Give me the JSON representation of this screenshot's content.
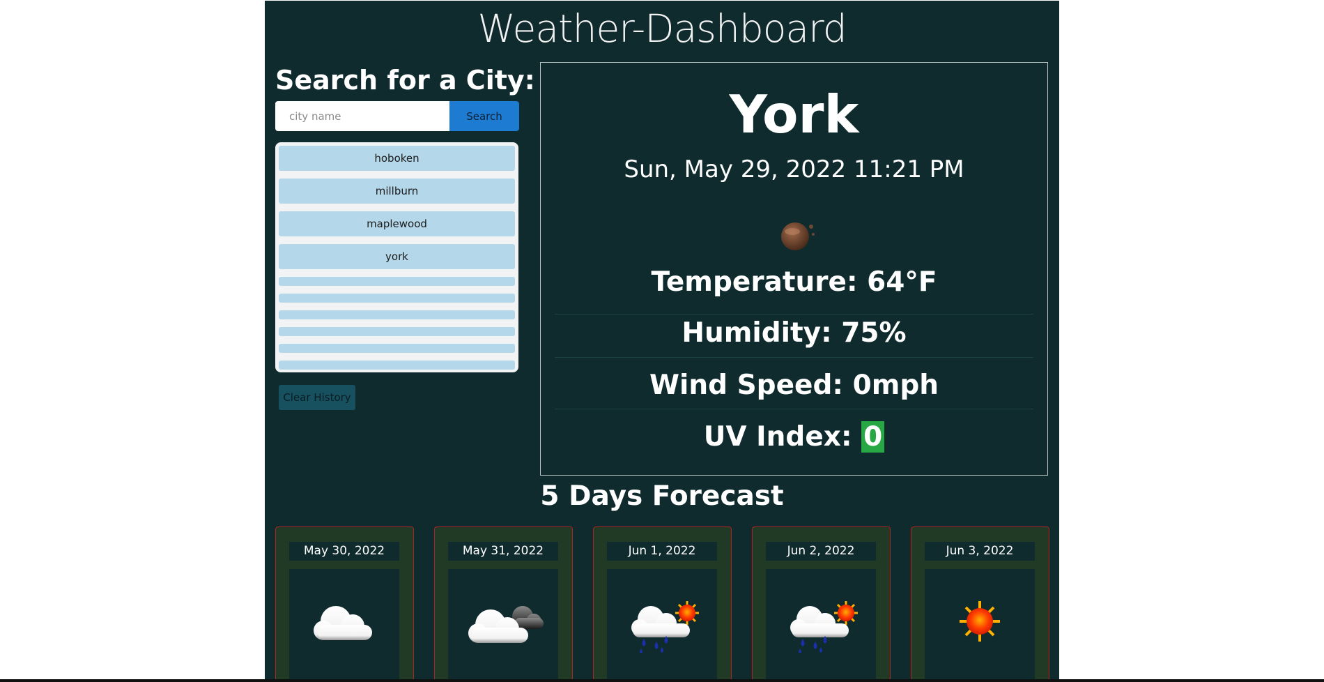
{
  "app": {
    "title": "Weather-Dashboard"
  },
  "search": {
    "heading": "Search for a City:",
    "placeholder": "city name",
    "button_label": "Search"
  },
  "history": {
    "items": [
      "hoboken",
      "millburn",
      "maplewood",
      "york"
    ],
    "clear_label": "Clear History"
  },
  "current": {
    "city": "York",
    "datetime": "Sun, May 29, 2022 11:21 PM",
    "icon": "night-partly-cloudy-moon-icon",
    "temperature_label": "Temperature:",
    "temperature_value": "64°F",
    "humidity_label": "Humidity:",
    "humidity_value": "75%",
    "wind_label": "Wind Speed:",
    "wind_value": "0mph",
    "uv_label": "UV Index:",
    "uv_value": "0",
    "uv_color": "#28a745"
  },
  "forecast": {
    "heading": "5 Days Forecast",
    "days": [
      {
        "date": "May 30, 2022",
        "icon": "cloud-icon"
      },
      {
        "date": "May 31, 2022",
        "icon": "partly-cloudy-night-icon"
      },
      {
        "date": "Jun 1, 2022",
        "icon": "rain-sun-icon"
      },
      {
        "date": "Jun 2, 2022",
        "icon": "rain-sun-icon"
      },
      {
        "date": "Jun 3, 2022",
        "icon": "sun-icon"
      }
    ]
  },
  "colors": {
    "background": "#0f2b2d",
    "search_button": "#1e7bd2",
    "history_item": "#b4d7ea",
    "forecast_border": "#b22222"
  }
}
